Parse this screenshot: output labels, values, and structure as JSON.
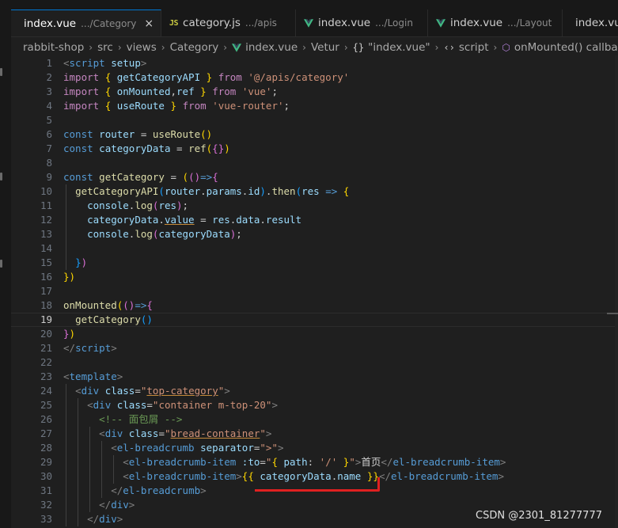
{
  "tabs": [
    {
      "name": "index.vue",
      "desc": ".../Category",
      "active": true,
      "close": "×",
      "icon": "vue-icon"
    },
    {
      "name": "category.js",
      "desc": ".../apis",
      "active": false,
      "icon": "js-icon",
      "icon_text": "JS"
    },
    {
      "name": "index.vue",
      "desc": ".../Login",
      "active": false,
      "icon": "vue-icon"
    },
    {
      "name": "index.vue",
      "desc": ".../Layout",
      "active": false,
      "icon": "vue-icon"
    },
    {
      "name": "index.vue",
      "desc": "",
      "active": false,
      "icon": "vue-icon"
    }
  ],
  "breadcrumb": {
    "items": [
      "rabbit-shop",
      "src",
      "views",
      "Category",
      "index.vue",
      "Vetur",
      "\"index.vue\"",
      "script",
      "onMounted() callback"
    ],
    "separator": "›"
  },
  "editor": {
    "current_line": 19,
    "line_numbers": [
      "1",
      "2",
      "3",
      "4",
      "5",
      "6",
      "7",
      "8",
      "9",
      "10",
      "11",
      "12",
      "13",
      "14",
      "15",
      "16",
      "17",
      "18",
      "19",
      "20",
      "21",
      "22",
      "23",
      "24",
      "25",
      "26",
      "27",
      "28",
      "29",
      "30",
      "31",
      "32",
      "33"
    ],
    "lines": [
      [
        [
          "tg",
          "<"
        ],
        [
          "tag",
          "script"
        ],
        [
          "p",
          " "
        ],
        [
          "at",
          "setup"
        ],
        [
          "tg",
          ">"
        ]
      ],
      [
        [
          "kw",
          "import"
        ],
        [
          "p",
          " "
        ],
        [
          "b1",
          "{"
        ],
        [
          "p",
          " "
        ],
        [
          "v",
          "getCategoryAPI"
        ],
        [
          "p",
          " "
        ],
        [
          "b1",
          "}"
        ],
        [
          "p",
          " "
        ],
        [
          "kw",
          "from"
        ],
        [
          "p",
          " "
        ],
        [
          "s",
          "'@/apis/category'"
        ]
      ],
      [
        [
          "kw",
          "import"
        ],
        [
          "p",
          " "
        ],
        [
          "b1",
          "{"
        ],
        [
          "p",
          " "
        ],
        [
          "v",
          "onMounted"
        ],
        [
          "p",
          ","
        ],
        [
          "v",
          "ref"
        ],
        [
          "p",
          " "
        ],
        [
          "b1",
          "}"
        ],
        [
          "p",
          " "
        ],
        [
          "kw",
          "from"
        ],
        [
          "p",
          " "
        ],
        [
          "s",
          "'vue'"
        ],
        [
          "p",
          ";"
        ]
      ],
      [
        [
          "kw",
          "import"
        ],
        [
          "p",
          " "
        ],
        [
          "b1",
          "{"
        ],
        [
          "p",
          " "
        ],
        [
          "v",
          "useRoute"
        ],
        [
          "p",
          " "
        ],
        [
          "b1",
          "}"
        ],
        [
          "p",
          " "
        ],
        [
          "kw",
          "from"
        ],
        [
          "p",
          " "
        ],
        [
          "s",
          "'vue-router'"
        ],
        [
          "p",
          ";"
        ]
      ],
      [],
      [
        [
          "k",
          "const"
        ],
        [
          "p",
          " "
        ],
        [
          "v",
          "router"
        ],
        [
          "p",
          " = "
        ],
        [
          "f",
          "useRoute"
        ],
        [
          "b1",
          "()"
        ]
      ],
      [
        [
          "k",
          "const"
        ],
        [
          "p",
          " "
        ],
        [
          "v",
          "categoryData"
        ],
        [
          "p",
          " = "
        ],
        [
          "f",
          "ref"
        ],
        [
          "b1",
          "("
        ],
        [
          "b2",
          "{}"
        ],
        [
          "b1",
          ")"
        ]
      ],
      [],
      [
        [
          "k",
          "const"
        ],
        [
          "p",
          " "
        ],
        [
          "f",
          "getCategory"
        ],
        [
          "p",
          " = "
        ],
        [
          "b1",
          "("
        ],
        [
          "b2",
          "()"
        ],
        [
          "k",
          "=>"
        ],
        [
          "b2",
          "{"
        ]
      ],
      [
        [
          "p",
          "  "
        ],
        [
          "f",
          "getCategoryAPI"
        ],
        [
          "b3",
          "("
        ],
        [
          "v",
          "router"
        ],
        [
          "p",
          "."
        ],
        [
          "v",
          "params"
        ],
        [
          "p",
          "."
        ],
        [
          "v",
          "id"
        ],
        [
          "b3",
          ")"
        ],
        [
          "p",
          "."
        ],
        [
          "f",
          "then"
        ],
        [
          "b3",
          "("
        ],
        [
          "v",
          "res"
        ],
        [
          "p",
          " "
        ],
        [
          "k",
          "=>"
        ],
        [
          "p",
          " "
        ],
        [
          "b1",
          "{"
        ]
      ],
      [
        [
          "p",
          "    "
        ],
        [
          "v",
          "console"
        ],
        [
          "p",
          "."
        ],
        [
          "f",
          "log"
        ],
        [
          "b2",
          "("
        ],
        [
          "v",
          "res"
        ],
        [
          "b2",
          ")"
        ],
        [
          "p",
          ";"
        ]
      ],
      [
        [
          "p",
          "    "
        ],
        [
          "v",
          "categoryData"
        ],
        [
          "p",
          "."
        ],
        [
          "v u",
          "value"
        ],
        [
          "p",
          " = "
        ],
        [
          "v",
          "res"
        ],
        [
          "p",
          "."
        ],
        [
          "v",
          "data"
        ],
        [
          "p",
          "."
        ],
        [
          "v",
          "result"
        ]
      ],
      [
        [
          "p",
          "    "
        ],
        [
          "v",
          "console"
        ],
        [
          "p",
          "."
        ],
        [
          "f",
          "log"
        ],
        [
          "b2",
          "("
        ],
        [
          "v",
          "categoryData"
        ],
        [
          "b2",
          ")"
        ],
        [
          "p",
          ";"
        ]
      ],
      [],
      [
        [
          "p",
          "  "
        ],
        [
          "b3",
          "}"
        ],
        [
          "b2",
          ")"
        ]
      ],
      [
        [
          "b1",
          "})"
        ]
      ],
      [],
      [
        [
          "f",
          "onMounted"
        ],
        [
          "b1",
          "("
        ],
        [
          "b2",
          "()"
        ],
        [
          "k",
          "=>"
        ],
        [
          "b2",
          "{"
        ]
      ],
      [
        [
          "p",
          "  "
        ],
        [
          "f",
          "getCategory"
        ],
        [
          "b3",
          "()"
        ]
      ],
      [
        [
          "b2",
          "}"
        ],
        [
          "b1",
          ")"
        ]
      ],
      [
        [
          "tg",
          "</"
        ],
        [
          "tag",
          "script"
        ],
        [
          "tg",
          ">"
        ]
      ],
      [],
      [
        [
          "tg",
          "<"
        ],
        [
          "tag",
          "template"
        ],
        [
          "tg",
          ">"
        ]
      ],
      [
        [
          "p",
          "  "
        ],
        [
          "tg",
          "<"
        ],
        [
          "tag",
          "div"
        ],
        [
          "p",
          " "
        ],
        [
          "at",
          "class"
        ],
        [
          "p",
          "="
        ],
        [
          "s",
          "\""
        ],
        [
          "s u",
          "top-category"
        ],
        [
          "s",
          "\""
        ],
        [
          "tg",
          ">"
        ]
      ],
      [
        [
          "p",
          "    "
        ],
        [
          "tg",
          "<"
        ],
        [
          "tag",
          "div"
        ],
        [
          "p",
          " "
        ],
        [
          "at",
          "class"
        ],
        [
          "p",
          "="
        ],
        [
          "s",
          "\"container m-top-20\""
        ],
        [
          "tg",
          ">"
        ]
      ],
      [
        [
          "p",
          "      "
        ],
        [
          "c",
          "<!-- 面包屑 -->"
        ]
      ],
      [
        [
          "p",
          "      "
        ],
        [
          "tg",
          "<"
        ],
        [
          "tag",
          "div"
        ],
        [
          "p",
          " "
        ],
        [
          "at",
          "class"
        ],
        [
          "p",
          "="
        ],
        [
          "s",
          "\""
        ],
        [
          "s u",
          "bread-container"
        ],
        [
          "s",
          "\""
        ],
        [
          "tg",
          ">"
        ]
      ],
      [
        [
          "p",
          "        "
        ],
        [
          "tg",
          "<"
        ],
        [
          "tag",
          "el-breadcrumb"
        ],
        [
          "p",
          " "
        ],
        [
          "at",
          "separator"
        ],
        [
          "p",
          "="
        ],
        [
          "s",
          "\">\""
        ],
        [
          "tg",
          ">"
        ]
      ],
      [
        [
          "p",
          "          "
        ],
        [
          "tg",
          "<"
        ],
        [
          "tag",
          "el-breadcrumb-item"
        ],
        [
          "p",
          " "
        ],
        [
          "at",
          ":to"
        ],
        [
          "p",
          "="
        ],
        [
          "s",
          "\""
        ],
        [
          "b1",
          "{"
        ],
        [
          "p",
          " "
        ],
        [
          "v",
          "path"
        ],
        [
          "p",
          ": "
        ],
        [
          "s",
          "'/'"
        ],
        [
          "p",
          " "
        ],
        [
          "b1",
          "}"
        ],
        [
          "s",
          "\""
        ],
        [
          "tg",
          ">"
        ],
        [
          "p",
          "首页"
        ],
        [
          "tg",
          "</"
        ],
        [
          "tag",
          "el-breadcrumb-item"
        ],
        [
          "tg",
          ">"
        ]
      ],
      [
        [
          "p",
          "          "
        ],
        [
          "tg",
          "<"
        ],
        [
          "tag",
          "el-breadcrumb-item"
        ],
        [
          "tg",
          ">"
        ],
        [
          "b1",
          "{{"
        ],
        [
          "p",
          " "
        ],
        [
          "v",
          "categoryData"
        ],
        [
          "p",
          "."
        ],
        [
          "v",
          "name"
        ],
        [
          "p",
          " "
        ],
        [
          "b1",
          "}}"
        ],
        [
          "tg",
          "</"
        ],
        [
          "tag",
          "el-breadcrumb-item"
        ],
        [
          "tg",
          ">"
        ]
      ],
      [
        [
          "p",
          "        "
        ],
        [
          "tg",
          "</"
        ],
        [
          "tag",
          "el-breadcrumb"
        ],
        [
          "tg",
          ">"
        ]
      ],
      [
        [
          "p",
          "      "
        ],
        [
          "tg",
          "</"
        ],
        [
          "tag",
          "div"
        ],
        [
          "tg",
          ">"
        ]
      ],
      [
        [
          "p",
          "    "
        ],
        [
          "tg",
          "</"
        ],
        [
          "tag",
          "div"
        ],
        [
          "tg",
          ">"
        ]
      ]
    ]
  },
  "watermark": "CSDN @2301_81277777"
}
